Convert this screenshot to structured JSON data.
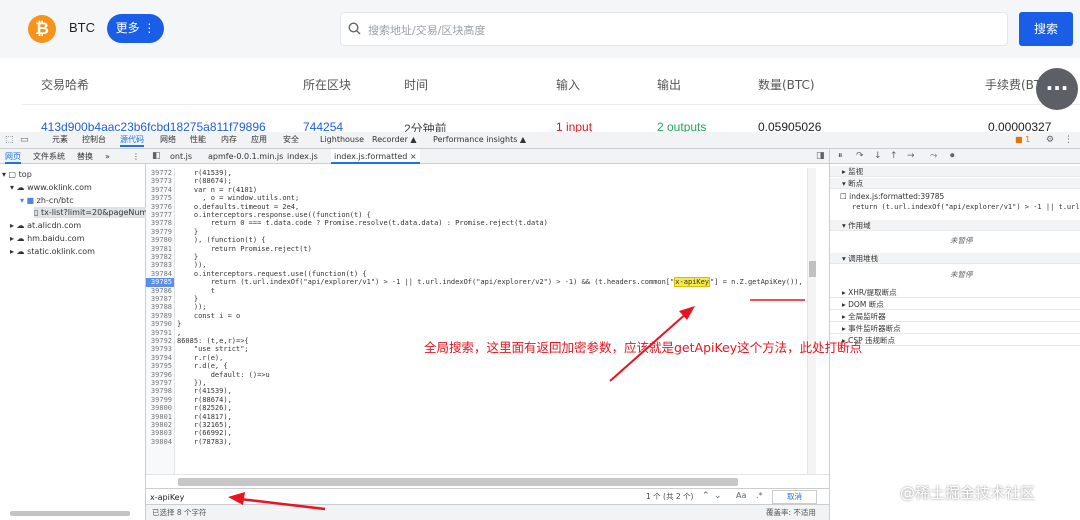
{
  "site": {
    "coin": "BTC",
    "more_button": "更多 ⋮",
    "search_placeholder": "搜索地址/交易/区块高度",
    "search_button": "搜索",
    "chat_icon": "chat-bubble-icon",
    "table_headers": [
      "交易哈希",
      "所在区块",
      "时间",
      "输入",
      "输出",
      "数量(BTC)",
      "手续费(BTC)"
    ],
    "row": {
      "hash": "413d900b4aac23b6fcbd18275a811f79896",
      "block": "744254",
      "time": "2分钟前",
      "inputs": "1 input",
      "outputs": "2 outputs",
      "amount": "0.05905026",
      "fee": "0.00000327"
    },
    "colors": {
      "brand": "#1a5ee8",
      "btc": "#f7931a",
      "link": "#1a5ee8",
      "input": "#e8141f",
      "output": "#22a557"
    }
  },
  "devtools": {
    "main_tabs": [
      "元素",
      "控制台",
      "源代码",
      "网络",
      "性能",
      "内存",
      "应用",
      "安全",
      "Lighthouse",
      "Recorder ▲",
      "Performance insights ▲"
    ],
    "issues_badge": "1",
    "left_tabs": [
      "网页",
      "文件系统",
      "替换"
    ],
    "tree": [
      "top",
      "www.oklink.com",
      "zh-cn/btc",
      "tx-list?limit=20&pageNum=1",
      "at.alicdn.com",
      "hm.baidu.com",
      "static.oklink.com"
    ],
    "file_tabs": [
      "ont.js",
      "apmfe-0.0.1.min.js",
      "index.js",
      "index.js:formatted ×"
    ],
    "line_numbers": [
      "39772",
      "39773",
      "39774",
      "39775",
      "39776",
      "39777",
      "39778",
      "39779",
      "39780",
      "39781",
      "39782",
      "39783",
      "39784",
      "39785",
      "39786",
      "39787",
      "39788",
      "39789",
      "39790",
      "39791",
      "39792",
      "39793",
      "39794",
      "39795",
      "39796",
      "39797",
      "39798",
      "39799",
      "39800",
      "39801",
      "39802",
      "39803",
      "39804"
    ],
    "breakpoint_line": "39785",
    "code_lines": [
      "    r(41539),",
      "    r(88674);",
      "    var n = r(4101)",
      "      , o = window.utils.ont;",
      "    o.defaults.timeout = 2e4,",
      "    o.interceptors.response.use((function(t) {",
      "        return 0 === t.data.code ? Promise.resolve(t.data.data) : Promise.reject(t.data)",
      "    }",
      "    ), (function(t) {",
      "        return Promise.reject(t)",
      "    }",
      "    )),",
      "    o.interceptors.request.use((function(t) {",
      "        return (t.url.indexOf(\"api/explorer/v1\") > -1 || t.url.indexOf(\"api/explorer/v2\") > -1) && (t.headers.common[\"",
      "        t",
      "    }",
      "    ));",
      "    const i = o",
      "}",
      ",",
      "86085: (t,e,r)=>{",
      "    \"use strict\";",
      "    r.r(e),",
      "    r.d(e, {",
      "        default: ()=>u",
      "    }),",
      "    r(41539),",
      "    r(88674),",
      "    r(82526),",
      "    r(41817),",
      "    r(32165),",
      "    r(66992),",
      "    r(78783),"
    ],
    "highlight_term": "x-apiKey",
    "highlight_tail": "\"] = n.Z.getApiKey()),",
    "annotation": "全局搜索，这里面有返回加密参数，应该就是getApiKey这个方法，此处打断点",
    "find": {
      "query": "x-apiKey",
      "count": "1 个 (共 2 个)",
      "case_label": "Aa",
      "regex_label": ".*",
      "cancel": "取消"
    },
    "status_left": "已选择 8 个字符",
    "status_right": "覆盖率: 不适用",
    "right_panel": {
      "sections": [
        "监视",
        "断点",
        "作用域",
        "调用堆栈",
        "XHR/提取断点",
        "DOM 断点",
        "全局监听器",
        "事件监听器断点",
        "CSP 违规断点"
      ],
      "bp_file": "index.js:formatted:39785",
      "bp_code": "return (t.url.indexOf(\"api/explorer/v1\") > -1 || t.url",
      "not_paused": "未暂停",
      "not_paused2": "未暂停"
    },
    "accent": "#1a73e8"
  },
  "watermark": "@稀土掘金技术社区"
}
